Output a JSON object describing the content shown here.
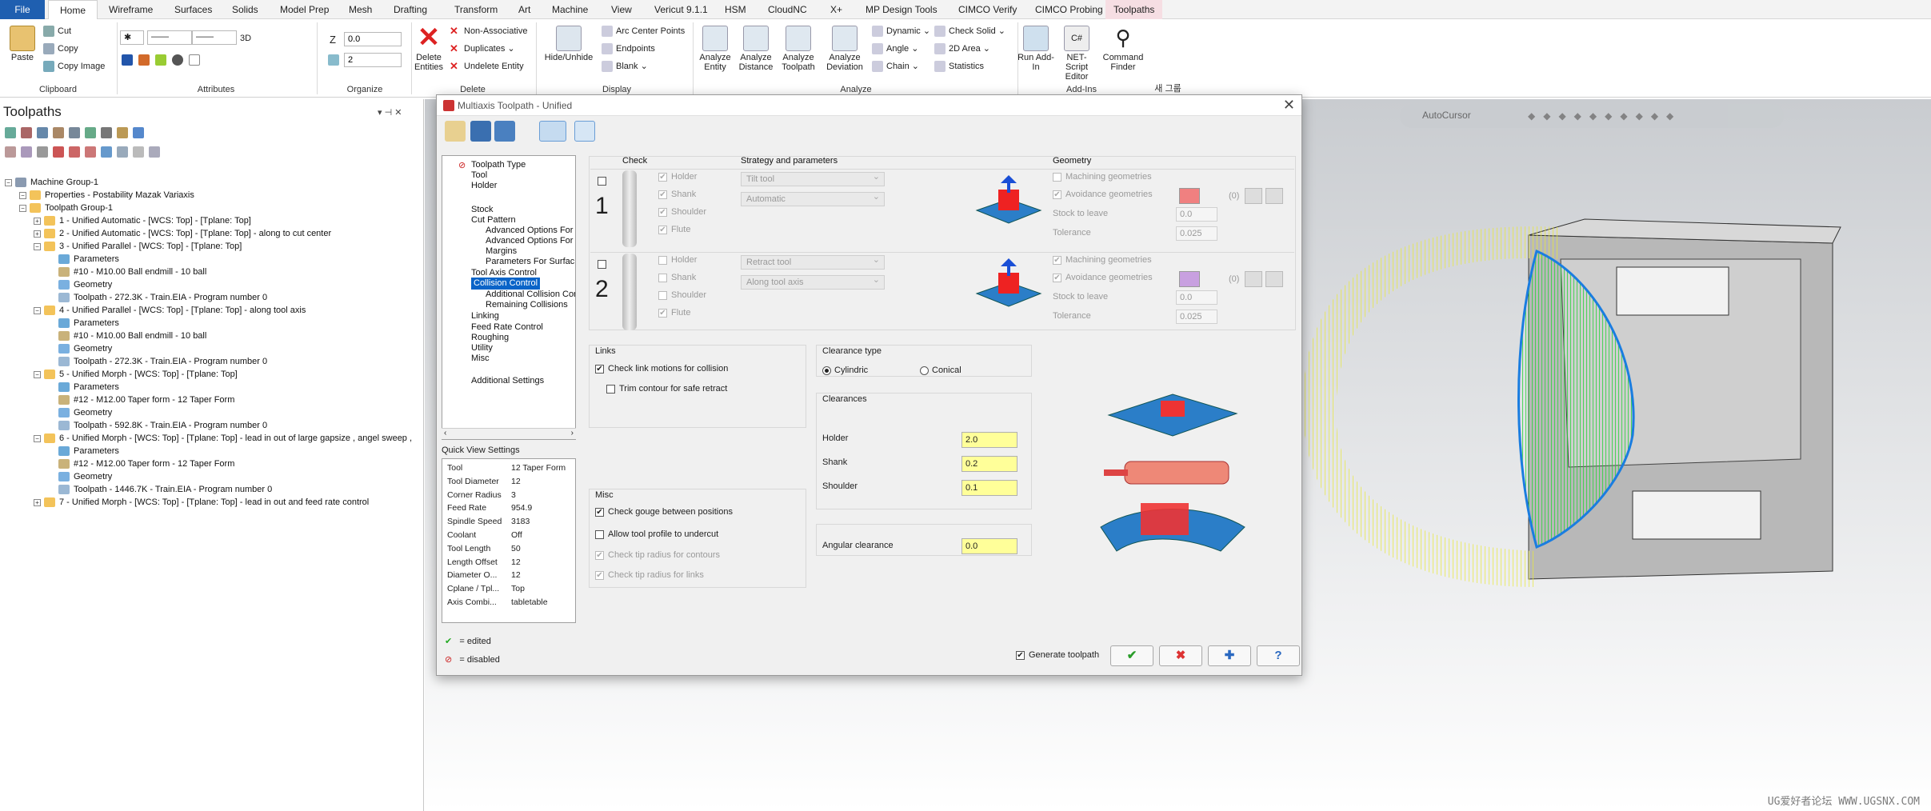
{
  "menu_tabs": [
    "File",
    "Home",
    "Wireframe",
    "Surfaces",
    "Solids",
    "Model Prep",
    "Mesh",
    "Drafting",
    "Transform",
    "Art",
    "Machine",
    "View",
    "Vericut 9.1.1",
    "HSM",
    "CloudNC",
    "X+",
    "MP Design Tools",
    "CIMCO Verify",
    "CIMCO Probing",
    "Toolpaths"
  ],
  "ribbon": {
    "clipboard": {
      "paste": "Paste",
      "cut": "Cut",
      "copy": "Copy",
      "copy_image": "Copy Image",
      "label": "Clipboard"
    },
    "attributes": {
      "label": "Attributes",
      "threed": "3D"
    },
    "organize": {
      "label": "Organize",
      "z_label": "Z",
      "z_value": "0.0",
      "level_value": "2"
    },
    "delete": {
      "delete_entities": "Delete Entities",
      "non_associative": "Non-Associative",
      "duplicates": "Duplicates",
      "undelete_entity": "Undelete Entity",
      "label": "Delete"
    },
    "display": {
      "hide_unhide": "Hide/Unhide",
      "arc_center_points": "Arc Center Points",
      "endpoints": "Endpoints",
      "blank": "Blank",
      "label": "Display"
    },
    "analyze": {
      "analyze_entity": "Analyze Entity",
      "analyze_distance": "Analyze Distance",
      "analyze_toolpath": "Analyze Toolpath",
      "analyze_deviation": "Analyze Deviation",
      "dynamic": "Dynamic",
      "angle": "Angle",
      "chain": "Chain",
      "check_solid": "Check Solid",
      "area_2d": "2D Area",
      "statistics": "Statistics",
      "label": "Analyze"
    },
    "addins": {
      "run_addin": "Run Add-In",
      "net_script": "NET-Script Editor",
      "command_finder": "Command Finder",
      "label": "Add-Ins",
      "extra": "새 그룹"
    }
  },
  "left_panel": {
    "title": "Toolpaths",
    "tree": [
      {
        "text": "Machine Group-1",
        "indent": 0
      },
      {
        "text": "Properties - Postability Mazak Variaxis",
        "indent": 1
      },
      {
        "text": "Toolpath Group-1",
        "indent": 1
      },
      {
        "text": "1 - Unified Automatic - [WCS: Top] - [Tplane: Top]",
        "indent": 2
      },
      {
        "text": "2 - Unified Automatic - [WCS: Top] - [Tplane: Top] - along to cut center",
        "indent": 2
      },
      {
        "text": "3 - Unified Parallel - [WCS: Top] - [Tplane: Top]",
        "indent": 2
      },
      {
        "text": "Parameters",
        "indent": 3
      },
      {
        "text": "#10 - M10.00 Ball endmill - 10 ball",
        "indent": 3
      },
      {
        "text": "Geometry",
        "indent": 3
      },
      {
        "text": "Toolpath - 272.3K - Train.EIA - Program number 0",
        "indent": 3
      },
      {
        "text": "4 - Unified Parallel - [WCS: Top] - [Tplane: Top] - along tool axis",
        "indent": 2
      },
      {
        "text": "Parameters",
        "indent": 3
      },
      {
        "text": "#10 - M10.00 Ball endmill - 10 ball",
        "indent": 3
      },
      {
        "text": "Geometry",
        "indent": 3
      },
      {
        "text": "Toolpath - 272.3K - Train.EIA - Program number 0",
        "indent": 3
      },
      {
        "text": "5 - Unified Morph - [WCS: Top] - [Tplane: Top]",
        "indent": 2
      },
      {
        "text": "Parameters",
        "indent": 3
      },
      {
        "text": "#12 - M12.00 Taper form - 12 Taper Form",
        "indent": 3
      },
      {
        "text": "Geometry",
        "indent": 3
      },
      {
        "text": "Toolpath - 592.8K - Train.EIA - Program number 0",
        "indent": 3
      },
      {
        "text": "6 - Unified Morph - [WCS: Top] - [Tplane: Top] - lead in out of large gapsize , angel sweep ,",
        "indent": 2
      },
      {
        "text": "Parameters",
        "indent": 3
      },
      {
        "text": "#12 - M12.00 Taper form - 12 Taper Form",
        "indent": 3
      },
      {
        "text": "Geometry",
        "indent": 3
      },
      {
        "text": "Toolpath - 1446.7K - Train.EIA - Program number 0",
        "indent": 3
      },
      {
        "text": "7 - Unified Morph - [WCS: Top] - [Tplane: Top] - lead in out and feed rate control",
        "indent": 2
      }
    ]
  },
  "viewport": {
    "autocursor": "AutoCursor"
  },
  "dialog": {
    "title": "Multiaxis Toolpath - Unified",
    "nav": [
      {
        "text": "Toolpath Type",
        "indent": 1
      },
      {
        "text": "Tool",
        "indent": 1
      },
      {
        "text": "Holder",
        "indent": 1
      },
      {
        "text": "Stock",
        "indent": 1
      },
      {
        "text": "Cut Pattern",
        "indent": 1
      },
      {
        "text": "Advanced Options For",
        "indent": 2
      },
      {
        "text": "Advanced Options For",
        "indent": 2
      },
      {
        "text": "Margins",
        "indent": 2
      },
      {
        "text": "Parameters For Surfac",
        "indent": 2
      },
      {
        "text": "Tool Axis Control",
        "indent": 1
      },
      {
        "text": "Collision Control",
        "indent": 1
      },
      {
        "text": "Additional Collision Cor",
        "indent": 2
      },
      {
        "text": "Remaining Collisions",
        "indent": 2
      },
      {
        "text": "Linking",
        "indent": 1
      },
      {
        "text": "Feed Rate Control",
        "indent": 1
      },
      {
        "text": "Roughing",
        "indent": 1
      },
      {
        "text": "Utility",
        "indent": 1
      },
      {
        "text": "Misc",
        "indent": 1
      },
      {
        "text": "Additional Settings",
        "indent": 1
      }
    ],
    "quick_view_title": "Quick View Settings",
    "quick_view": [
      {
        "k": "Tool",
        "v": "12 Taper Form"
      },
      {
        "k": "Tool Diameter",
        "v": "12"
      },
      {
        "k": "Corner Radius",
        "v": "3"
      },
      {
        "k": "Feed Rate",
        "v": "954.9"
      },
      {
        "k": "Spindle Speed",
        "v": "3183"
      },
      {
        "k": "Coolant",
        "v": "Off"
      },
      {
        "k": "Tool Length",
        "v": "50"
      },
      {
        "k": "Length Offset",
        "v": "12"
      },
      {
        "k": "Diameter O...",
        "v": "12"
      },
      {
        "k": "Cplane / Tpl...",
        "v": "Top"
      },
      {
        "k": "Axis Combi...",
        "v": "tabletable"
      }
    ],
    "legend_edited": "= edited",
    "legend_disabled": "= disabled",
    "headers": {
      "check": "Check",
      "strategy": "Strategy and parameters",
      "geometry": "Geometry"
    },
    "rows": [
      {
        "num": "1",
        "checks": [
          "Holder",
          "Shank",
          "Shoulder",
          "Flute"
        ],
        "strategy": "Tilt tool",
        "param": "Automatic",
        "machining_geom": "Machining geometries",
        "avoidance_geom": "Avoidance geometries",
        "count": "(0)",
        "stock_label": "Stock to leave",
        "stock": "0.0",
        "tol_label": "Tolerance",
        "tol": "0.025",
        "swatch": "#f08080"
      },
      {
        "num": "2",
        "checks": [
          "Holder",
          "Shank",
          "Shoulder",
          "Flute"
        ],
        "strategy": "Retract tool",
        "param": "Along tool axis",
        "machining_geom": "Machining geometries",
        "avoidance_geom": "Avoidance geometries",
        "count": "(0)",
        "stock_label": "Stock to leave",
        "stock": "0.0",
        "tol_label": "Tolerance",
        "tol": "0.025",
        "swatch": "#c8a0e0"
      }
    ],
    "links": {
      "title": "Links",
      "check_link": "Check link motions for collision",
      "trim": "Trim contour for safe retract"
    },
    "misc": {
      "title": "Misc",
      "gouge": "Check gouge between positions",
      "undercut": "Allow tool profile to undercut",
      "tip_contours": "Check tip radius for contours",
      "tip_links": "Check tip radius for links"
    },
    "clearance_type": {
      "title": "Clearance type",
      "cylindric": "Cylindric",
      "conical": "Conical"
    },
    "clearances": {
      "title": "Clearances",
      "holder_label": "Holder",
      "holder": "2.0",
      "shank_label": "Shank",
      "shank": "0.2",
      "shoulder_label": "Shoulder",
      "shoulder": "0.1"
    },
    "angular": {
      "label": "Angular clearance",
      "value": "0.0"
    },
    "generate": "Generate toolpath",
    "buttons": {
      "ok": "✔",
      "cancel": "✖",
      "add": "✚",
      "help": "?"
    }
  },
  "watermark": "UG爱好者论坛 WWW.UGSNX.COM",
  "colors": {
    "file_tab": "#1f5fb0",
    "select": "#0a64c8",
    "yellow_field": "#ffff99",
    "toolpath_yellow": "#e8e838",
    "toolpath_green": "#33cc33"
  }
}
